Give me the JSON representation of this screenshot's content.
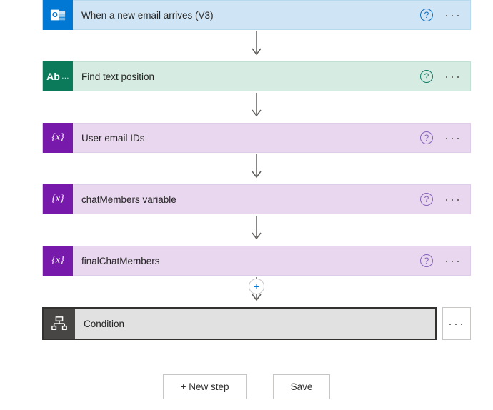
{
  "steps": [
    {
      "label": "When a new email arrives (V3)",
      "theme": "outlook",
      "iconName": "outlook-icon",
      "iconGlyph": "O▤"
    },
    {
      "label": "Find text position",
      "theme": "text",
      "iconName": "text-ops-icon",
      "iconGlyph": "Ab ..."
    },
    {
      "label": "User email IDs",
      "theme": "variable",
      "iconName": "variable-icon",
      "iconGlyph": "{x}"
    },
    {
      "label": "chatMembers variable",
      "theme": "variable",
      "iconName": "variable-icon",
      "iconGlyph": "{x}"
    },
    {
      "label": "finalChatMembers",
      "theme": "variable",
      "iconName": "variable-icon",
      "iconGlyph": "{x}"
    }
  ],
  "condition": {
    "label": "Condition",
    "iconGlyph": "⊤"
  },
  "buttons": {
    "new_step": "+ New step",
    "save": "Save"
  },
  "glyphs": {
    "help": "?",
    "menu": "···",
    "plus": "+"
  }
}
